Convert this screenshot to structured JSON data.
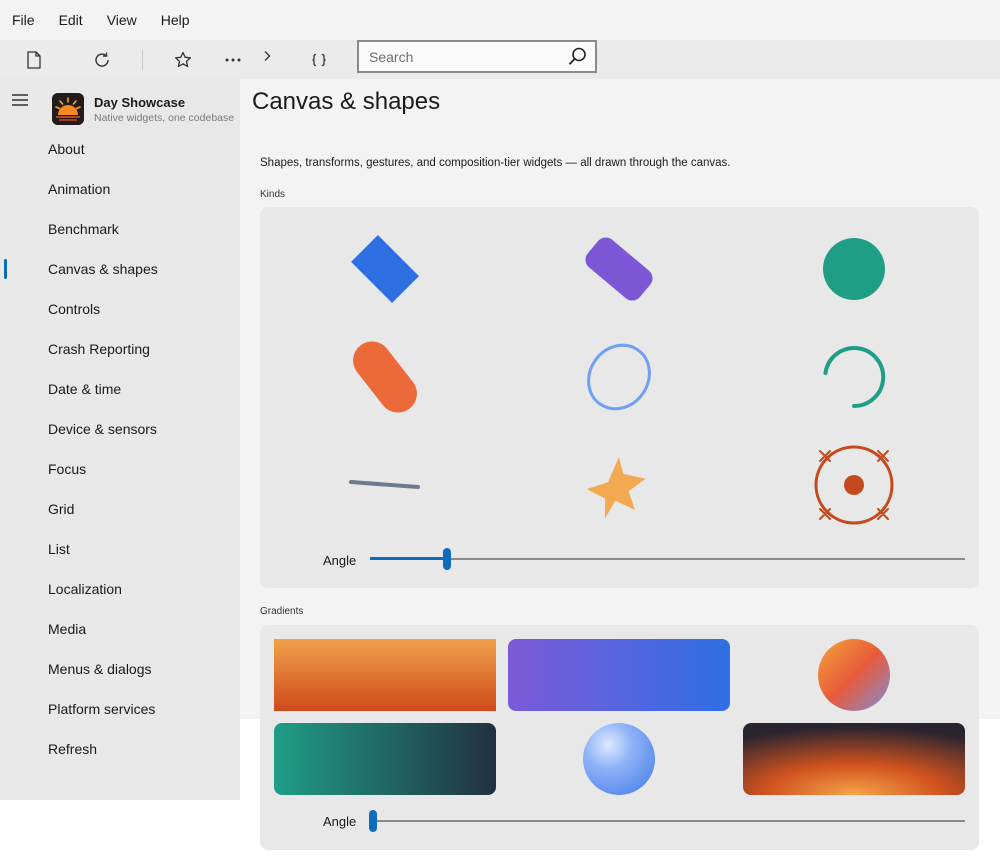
{
  "menubar": {
    "items": [
      "File",
      "Edit",
      "View",
      "Help"
    ]
  },
  "toolbar": {
    "search": {
      "placeholder": "Search",
      "value": ""
    }
  },
  "app": {
    "title": "Day Showcase",
    "subtitle": "Native widgets, one codebase"
  },
  "sidebar": {
    "active_index": 3,
    "items": [
      {
        "label": "About"
      },
      {
        "label": "Animation"
      },
      {
        "label": "Benchmark"
      },
      {
        "label": "Canvas & shapes"
      },
      {
        "label": "Controls"
      },
      {
        "label": "Crash Reporting"
      },
      {
        "label": "Date & time"
      },
      {
        "label": "Device & sensors"
      },
      {
        "label": "Focus"
      },
      {
        "label": "Grid"
      },
      {
        "label": "List"
      },
      {
        "label": "Localization"
      },
      {
        "label": "Media"
      },
      {
        "label": "Menus & dialogs"
      },
      {
        "label": "Platform services"
      },
      {
        "label": "Refresh"
      }
    ]
  },
  "page": {
    "title": "Canvas & shapes",
    "description": "Shapes, transforms, gestures, and composition-tier widgets — all drawn through the canvas.",
    "kinds": {
      "label": "Kinds",
      "angle_label": "Angle",
      "angle_fraction": 0.13,
      "colors": {
        "blue": "#2f6fe4",
        "purple": "#7c57d6",
        "teal": "#1f9e86",
        "orange": "#ec6a3a",
        "light_blue": "#6fa0f5",
        "slate": "#6c7a8c",
        "amber": "#f2a950",
        "rust": "#c44a1d"
      }
    },
    "gradients": {
      "label": "Gradients",
      "angle_label": "Angle",
      "angle_fraction": 0.0
    }
  }
}
